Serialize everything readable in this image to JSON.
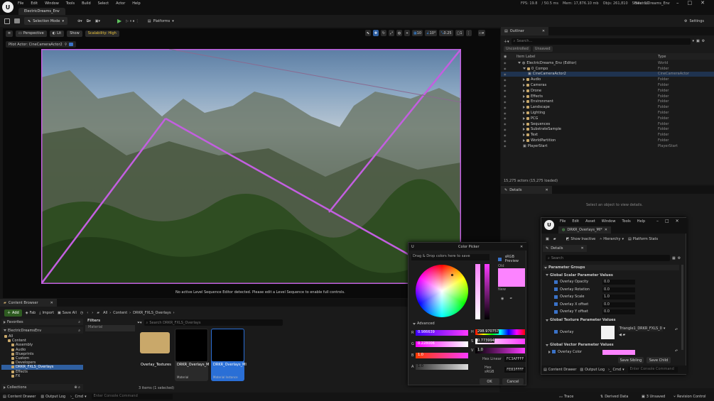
{
  "titlebar": {
    "tab": "ElectricDreams_Env",
    "menus": [
      "File",
      "Edit",
      "Window",
      "Tools",
      "Build",
      "Select",
      "Actor",
      "Help"
    ],
    "project": "ElectricDreams_Env"
  },
  "stats": {
    "fps": "FPS: 19.8",
    "ms": "/ 50.5 ms",
    "mem": "Mem: 17,876.10 mb",
    "objs": "Objs: 261,810",
    "stalls": "Stalls: 12"
  },
  "toolbar": {
    "selection_mode": "Selection Mode",
    "platforms": "Platforms",
    "settings": "Settings"
  },
  "viewport": {
    "perspective": "Perspective",
    "lit": "Lit",
    "show": "Show",
    "scalability": "Scalability: High",
    "pilot": "Pilot Actor: CineCameraActor2",
    "notice": "No active Level Sequence Editor detected. Please edit a Level Sequence to enable full controls.",
    "tb_right": [
      "10",
      "10°",
      "0.25",
      "1"
    ],
    "grid_color": "#b04bd0"
  },
  "outliner": {
    "tab": "Outliner",
    "search": "Search...",
    "filters": [
      "Unsaved",
      "Uncontrolled"
    ],
    "col_label": "Item Label",
    "col_type": "Type",
    "footer": "15,275 actors (15,275 loaded)",
    "rows": [
      {
        "label": "ElectricDreams_Env (Editor)",
        "type": "World",
        "d": 0
      },
      {
        "label": "0_Compo",
        "type": "Folder",
        "d": 1
      },
      {
        "label": "CineCameraActor2",
        "type": "CineCameraActor",
        "d": 2
      },
      {
        "label": "Audio",
        "type": "Folder",
        "d": 1
      },
      {
        "label": "Cameras",
        "type": "Folder",
        "d": 1
      },
      {
        "label": "Drone",
        "type": "Folder",
        "d": 1
      },
      {
        "label": "Effects",
        "type": "Folder",
        "d": 1
      },
      {
        "label": "Environment",
        "type": "Folder",
        "d": 1
      },
      {
        "label": "Landscape",
        "type": "Folder",
        "d": 1
      },
      {
        "label": "Lighting",
        "type": "Folder",
        "d": 1
      },
      {
        "label": "PCG",
        "type": "Folder",
        "d": 1
      },
      {
        "label": "Sequences",
        "type": "Folder",
        "d": 1
      },
      {
        "label": "SubstrateSample",
        "type": "Folder",
        "d": 1
      },
      {
        "label": "Text",
        "type": "Folder",
        "d": 1
      },
      {
        "label": "WorldPartition",
        "type": "Folder",
        "d": 1
      },
      {
        "label": "PlayerStart",
        "type": "PlayerStart",
        "d": 1
      }
    ]
  },
  "details": {
    "tab": "Details",
    "hint": "Select an object to view details."
  },
  "content": {
    "tab": "Content Browser",
    "add": "Add",
    "fab": "Fab",
    "import": "Import",
    "save_all": "Save All",
    "path": [
      "All",
      "Content",
      "DRKR_FXLS_Overlays"
    ],
    "favorites": "Favorites",
    "project": "ElectricDreamsEnv",
    "filters": "Filters",
    "filter_item": "Material",
    "search": "Search DRKR_FXLS_Overlays",
    "collections": "Collections",
    "count": "3 items (1 selected)",
    "tree": [
      "All",
      "Content",
      "Assembly",
      "Audio",
      "Blueprints",
      "Custom",
      "Developers",
      "DRKR_FXLS_Overlays",
      "Effects",
      "FX"
    ],
    "assets": [
      {
        "name": "Overlay_Textures",
        "sub": "",
        "type": "folder"
      },
      {
        "name": "DRKR_Overlays_M",
        "sub": "Material",
        "type": "mat"
      },
      {
        "name": "DRKR_Overlays_MI",
        "sub": "Material Instance",
        "type": "mat"
      }
    ]
  },
  "color_picker": {
    "title": "Color Picker",
    "drag_hint": "Drag & Drop colors here to save",
    "srgb": "sRGB Preview",
    "old": "Old",
    "new": "New",
    "advanced": "Advanced",
    "R": "0.986639",
    "G": "0.228006",
    "B": "1.0",
    "A": "1.0",
    "H": "298.970757",
    "S": "0.773994",
    "V": "1.0",
    "hex_linear_label": "Hex Linear",
    "hex_linear": "FC3AFFFF",
    "hex_srgb_label": "Hex sRGB",
    "hex_srgb": "FE83FFFF",
    "ok": "OK",
    "cancel": "Cancel",
    "color": "#fc83ff"
  },
  "mat_editor": {
    "menus": [
      "File",
      "Edit",
      "Asset",
      "Window",
      "Tools",
      "Help"
    ],
    "tab": "DRKR_Overlays_MI*",
    "show_inactive": "Show Inactive",
    "hierarchy": "Hierarchy",
    "platform_stats": "Platform Stats",
    "details": "Details",
    "search": "Search",
    "param_groups": "Parameter Groups",
    "scalar_group": "Global Scalar Parameter Values",
    "scalars": [
      {
        "name": "Overlay Opacity",
        "value": "0.0"
      },
      {
        "name": "Overlay Rotation",
        "value": "0.0"
      },
      {
        "name": "Overlay Scale",
        "value": "1.0"
      },
      {
        "name": "Overlay X offset",
        "value": "0.0"
      },
      {
        "name": "Overlay Y offset",
        "value": "0.0"
      }
    ],
    "texture_group": "Global Texture Parameter Values",
    "texture_param": "Overlay",
    "texture_value": "Triangle1_DRKR_FXLS_0",
    "vector_group": "Global Vector Parameter Values",
    "vector_param": "Overlay Color",
    "save_sibling": "Save Sibling",
    "save_child": "Save Child",
    "content_drawer": "Content Drawer",
    "output_log": "Output Log",
    "cmd": "Cmd",
    "console": "Enter Console Command"
  },
  "statusbar": {
    "content_drawer": "Content Drawer",
    "output_log": "Output Log",
    "cmd": "Cmd",
    "console": "Enter Console Command",
    "trace": "Trace",
    "derived": "Derived Data",
    "unsaved": "3 Unsaved",
    "revision": "Revision Control"
  }
}
